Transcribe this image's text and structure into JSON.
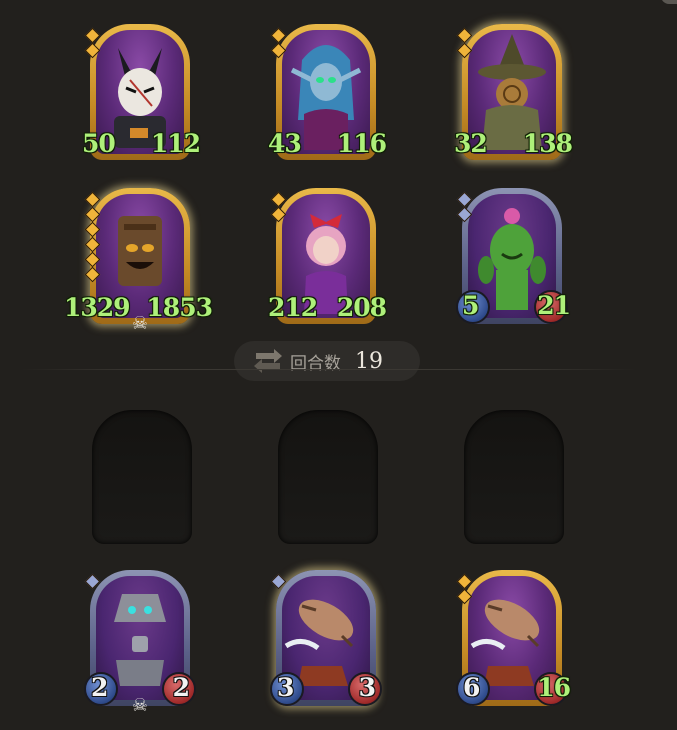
{
  "turn": {
    "label": "回合数",
    "value": "19",
    "icon": "swap-arrows-icon"
  },
  "enemy_board": [
    {
      "name": "rabbit-mask-card",
      "frame": "gold",
      "tier_pips": 2,
      "attack": "50",
      "health": "112",
      "glow": false,
      "health_marker": "target"
    },
    {
      "name": "elf-lady-card",
      "frame": "gold",
      "tier_pips": 2,
      "attack": "43",
      "health": "116",
      "glow": false
    },
    {
      "name": "witch-hat-card",
      "frame": "gold",
      "tier_pips": 2,
      "attack": "32",
      "health": "138",
      "glow": true
    },
    {
      "name": "totem-mask-card",
      "frame": "gold",
      "tier_pips": 6,
      "attack": "1329",
      "health": "1853",
      "glow": true,
      "deathrattle": true
    },
    {
      "name": "bow-girl-card",
      "frame": "gold",
      "tier_pips": 2,
      "attack": "212",
      "health": "208",
      "glow": false
    },
    {
      "name": "cactus-card",
      "frame": "silver",
      "tier_pips": 2,
      "attack": "5",
      "health": "21",
      "glow": false
    }
  ],
  "player_board": [
    {
      "name": "robot-bell-card",
      "frame": "silver",
      "tier_pips": 1,
      "attack": "2",
      "health": "2",
      "glow": false,
      "deathrattle": true
    },
    {
      "name": "blimp-card",
      "frame": "silver",
      "tier_pips": 1,
      "attack": "3",
      "health": "3",
      "glow": true
    },
    {
      "name": "blimp-gold-card",
      "frame": "gold",
      "tier_pips": 2,
      "attack": "6",
      "health": "16",
      "glow": false
    }
  ],
  "empty_slots": 3
}
